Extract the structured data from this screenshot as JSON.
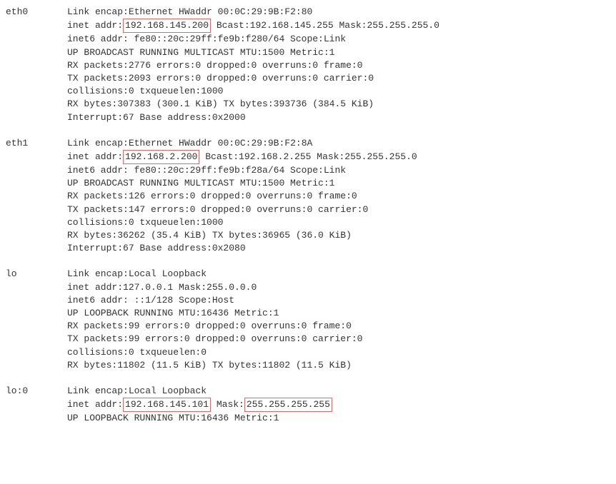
{
  "eth0": {
    "name": "eth0",
    "l1_prefix": "Link encap:",
    "l1_encap": "Ethernet",
    "l1_hw_label": "  HWaddr ",
    "l1_hw": "00:0C:29:9B:F2:80",
    "l2_prefix": "inet addr:",
    "l2_ip": "192.168.145.200",
    "l2_rest": "  Bcast:192.168.145.255  Mask:255.255.255.0",
    "l3": "inet6 addr: fe80::20c:29ff:fe9b:f280/64 Scope:Link",
    "l4": "UP BROADCAST RUNNING MULTICAST  MTU:1500  Metric:1",
    "l5": "RX packets:2776 errors:0 dropped:0 overruns:0 frame:0",
    "l6": "TX packets:2093 errors:0 dropped:0 overruns:0 carrier:0",
    "l7": "collisions:0 txqueuelen:1000",
    "l8": "RX bytes:307383 (300.1 KiB)  TX bytes:393736 (384.5 KiB)",
    "l9": "Interrupt:67 Base address:0x2000"
  },
  "eth1": {
    "name": "eth1",
    "l1_prefix": "Link encap:",
    "l1_encap": "Ethernet",
    "l1_hw_label": "  HWaddr ",
    "l1_hw": "00:0C:29:9B:F2:8A",
    "l2_prefix": "inet addr:",
    "l2_ip": "192.168.2.200",
    "l2_rest": "  Bcast:192.168.2.255  Mask:255.255.255.0",
    "l3": "inet6 addr: fe80::20c:29ff:fe9b:f28a/64 Scope:Link",
    "l4": "UP BROADCAST RUNNING MULTICAST  MTU:1500  Metric:1",
    "l5": "RX packets:126 errors:0 dropped:0 overruns:0 frame:0",
    "l6": "TX packets:147 errors:0 dropped:0 overruns:0 carrier:0",
    "l7": "collisions:0 txqueuelen:1000",
    "l8": "RX bytes:36262 (35.4 KiB)  TX bytes:36965 (36.0 KiB)",
    "l9": "Interrupt:67 Base address:0x2080"
  },
  "lo": {
    "name": "lo",
    "l1": "Link encap:Local Loopback",
    "l2": "inet addr:127.0.0.1  Mask:255.0.0.0",
    "l3": "inet6 addr: ::1/128 Scope:Host",
    "l4": "UP LOOPBACK RUNNING  MTU:16436  Metric:1",
    "l5": "RX packets:99 errors:0 dropped:0 overruns:0 frame:0",
    "l6": "TX packets:99 errors:0 dropped:0 overruns:0 carrier:0",
    "l7": "collisions:0 txqueuelen:0",
    "l8": "RX bytes:11802 (11.5 KiB)  TX bytes:11802 (11.5 KiB)"
  },
  "lo0": {
    "name": "lo:0",
    "l1": "Link encap:Local Loopback",
    "l2_prefix": "inet addr:",
    "l2_ip": "192.168.145.101",
    "l2_mid": "  Mask:",
    "l2_mask": "255.255.255.255",
    "l3": "UP LOOPBACK RUNNING  MTU:16436  Metric:1"
  }
}
